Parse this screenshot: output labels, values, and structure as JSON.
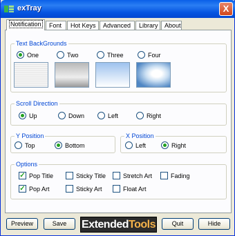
{
  "window": {
    "title": "exTray",
    "close_label": "X"
  },
  "tabs": [
    "Notification",
    "Font",
    "Hot Keys",
    "Advanced",
    "Library",
    "About"
  ],
  "backgrounds": {
    "label": "Text BackGrounds",
    "options": [
      "One",
      "Two",
      "Three",
      "Four"
    ],
    "selected": "One"
  },
  "scroll": {
    "label": "Scroll Direction",
    "options": [
      "Up",
      "Down",
      "Left",
      "Right"
    ],
    "selected": "Up"
  },
  "ypos": {
    "label": "Y Position",
    "options": [
      "Top",
      "Bottom"
    ],
    "selected": "Bottom"
  },
  "xpos": {
    "label": "X Position",
    "options": [
      "Left",
      "Right"
    ],
    "selected": "Right"
  },
  "options": {
    "label": "Options",
    "items": [
      {
        "label": "Pop Title",
        "checked": true
      },
      {
        "label": "Sticky Title",
        "checked": false
      },
      {
        "label": "Stretch Art",
        "checked": false
      },
      {
        "label": "Fading",
        "checked": false
      },
      {
        "label": "Pop Art",
        "checked": true
      },
      {
        "label": "Sticky Art",
        "checked": false
      },
      {
        "label": "Float Art",
        "checked": false
      }
    ]
  },
  "buttons": {
    "preview": "Preview",
    "save": "Save",
    "quit": "Quit",
    "hide": "Hide"
  },
  "logo": {
    "part1": "Extended",
    "part2": "Tools"
  },
  "colors": {
    "title_bar": "#0554e1",
    "group_label": "#0046d5",
    "radio_selected": "#21a121"
  }
}
